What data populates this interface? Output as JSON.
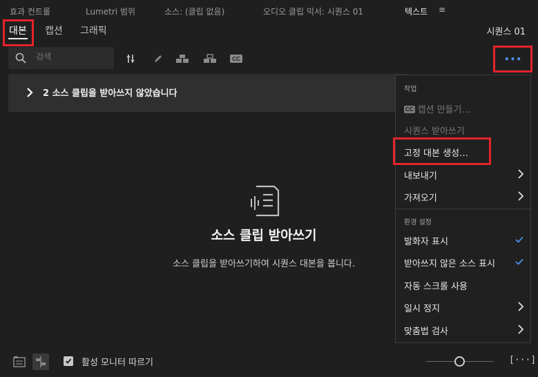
{
  "panel_tabs": [
    {
      "label": "효과 컨트롤"
    },
    {
      "label": "Lumetri 범위"
    },
    {
      "label": "소스: (클립 없음)"
    },
    {
      "label": "오디오 클립 믹서: 시퀀스 01"
    },
    {
      "label": "텍스트"
    }
  ],
  "panel_menu_glyph": "≡",
  "subtabs": [
    {
      "label": "대본"
    },
    {
      "label": "캡션"
    },
    {
      "label": "그래픽"
    }
  ],
  "sequence_name": "시퀀스 01",
  "search": {
    "placeholder": "검색",
    "value": ""
  },
  "toolbar": {
    "icons": [
      "split-segment-icon",
      "pencil-icon",
      "merge-segments-icon",
      "speaker-icon",
      "captions-icon"
    ],
    "more_label": "•••"
  },
  "banner": {
    "text": "2 소스 클립을 받아쓰지 않았습니다"
  },
  "empty_state": {
    "title": "소스 클립 받아쓰기",
    "description": "소스 클립을 받아쓰기하여 시퀀스 대본을 봅니다."
  },
  "menu": {
    "section_work": "작업",
    "create_captions": "캡션 만들기…",
    "transcribe_sequence": "시퀀스 받아쓰기",
    "generate_static_transcript": "고정 대본 생성…",
    "export": "내보내기",
    "import": "가져오기",
    "section_preferences": "환경 설정",
    "show_speakers": "발화자 표시",
    "show_untranscribed": "받아쓰지 않은 소스 표시",
    "auto_scroll": "자동 스크롤 사용",
    "pause": "일시 정지",
    "spell_check": "맞춤법 검사",
    "show_speakers_checked": true,
    "show_untranscribed_checked": true
  },
  "bottom": {
    "follow_monitor_label": "활성 모니터 따르기",
    "follow_monitor_checked": true,
    "zoom_fit_label": "[···]",
    "zoom_level": 0.5
  },
  "colors": {
    "highlight": "#e5232b",
    "accent_blue": "#4a8fe8",
    "background": "#1f1f1f"
  }
}
